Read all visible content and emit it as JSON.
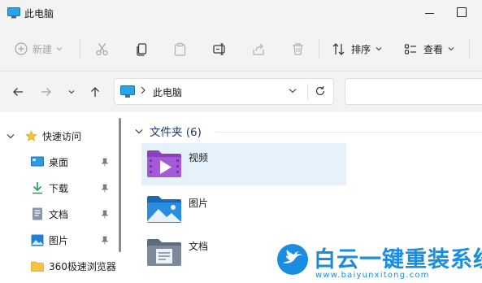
{
  "window": {
    "title": "此电脑"
  },
  "toolbar": {
    "new_label": "新建",
    "sort_label": "排序",
    "view_label": "查看"
  },
  "address": {
    "current": "此电脑"
  },
  "nav": {
    "quick_access": "快速访问",
    "items": [
      {
        "label": "桌面",
        "icon": "desktop-icon",
        "pinned": true
      },
      {
        "label": "下载",
        "icon": "download-icon",
        "pinned": true
      },
      {
        "label": "文档",
        "icon": "document-icon",
        "pinned": true
      },
      {
        "label": "图片",
        "icon": "pictures-icon",
        "pinned": true
      },
      {
        "label": "360极速浏览器",
        "icon": "folder-icon",
        "pinned": false
      }
    ]
  },
  "content": {
    "group_header": "文件夹 (6)",
    "folders": [
      {
        "name": "视频",
        "icon": "videos-folder-icon",
        "selected": true
      },
      {
        "name": "图片",
        "icon": "pictures-folder-icon",
        "selected": false
      },
      {
        "name": "文档",
        "icon": "documents-folder-icon",
        "selected": false
      }
    ]
  },
  "watermark": {
    "title": "白云一键重装系统",
    "url": "www.baiyunxitong.com"
  },
  "colors": {
    "accent": "#1a8de0",
    "selection": "#e5f1fb",
    "folder_header": "#1f3864"
  }
}
